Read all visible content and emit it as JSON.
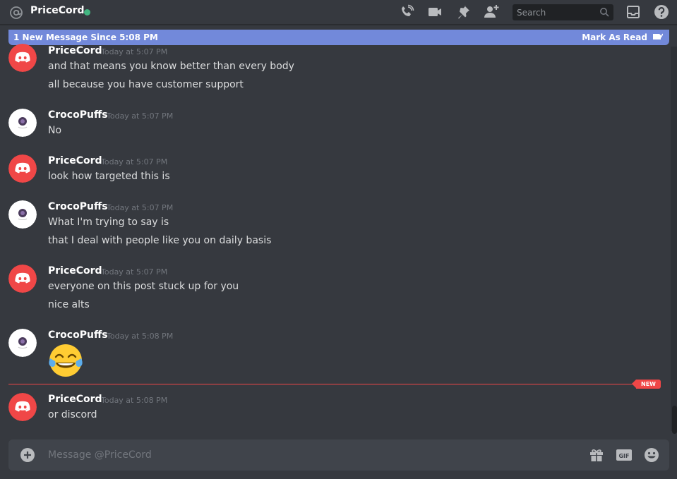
{
  "header": {
    "channel_name": "PriceCord",
    "status_color": "#43b581",
    "icons": [
      "at-icon",
      "phone-call-icon",
      "video-call-icon",
      "pin-icon",
      "add-friend-icon",
      "inbox-icon",
      "help-icon"
    ],
    "search": {
      "placeholder": "Search"
    }
  },
  "new_bar": {
    "text": "1 New Message Since 5:08 PM",
    "action": "Mark As Read"
  },
  "messages": [
    {
      "author": "PriceCord",
      "timestamp": "Today at 5:07 PM",
      "avatar": "discord-logo-red",
      "lines": [
        "and that means you know better than every body",
        "all because you have customer support"
      ]
    },
    {
      "author": "CrocoPuffs",
      "timestamp": "Today at 5:07 PM",
      "avatar": "white-circle-avatar",
      "lines": [
        "No"
      ]
    },
    {
      "author": "PriceCord",
      "timestamp": "Today at 5:07 PM",
      "avatar": "discord-logo-red",
      "lines": [
        "look how targeted this is"
      ]
    },
    {
      "author": "CrocoPuffs",
      "timestamp": "Today at 5:07 PM",
      "avatar": "white-circle-avatar",
      "lines": [
        "What I'm trying to say is",
        "that I deal with people like you on daily basis"
      ]
    },
    {
      "author": "PriceCord",
      "timestamp": "Today at 5:07 PM",
      "avatar": "discord-logo-red",
      "lines": [
        "everyone on this post stuck up for you",
        "nice alts"
      ]
    },
    {
      "author": "CrocoPuffs",
      "timestamp": "Today at 5:08 PM",
      "avatar": "white-circle-avatar",
      "lines": [],
      "emoji": "face-with-tears-of-joy"
    },
    {
      "author": "PriceCord",
      "timestamp": "Today at 5:08 PM",
      "avatar": "discord-logo-red",
      "lines": [
        "or discord"
      ]
    }
  ],
  "divider": {
    "label": "NEW",
    "color": "#f04747"
  },
  "composer": {
    "placeholder": "Message @PriceCord",
    "icons": [
      "add-attachment-icon",
      "gift-icon",
      "gif-icon",
      "emoji-picker-icon"
    ]
  },
  "colors": {
    "background": "#36393f",
    "accent": "#7289da",
    "discord_red": "#f04747",
    "composer_bg": "#40444b"
  }
}
